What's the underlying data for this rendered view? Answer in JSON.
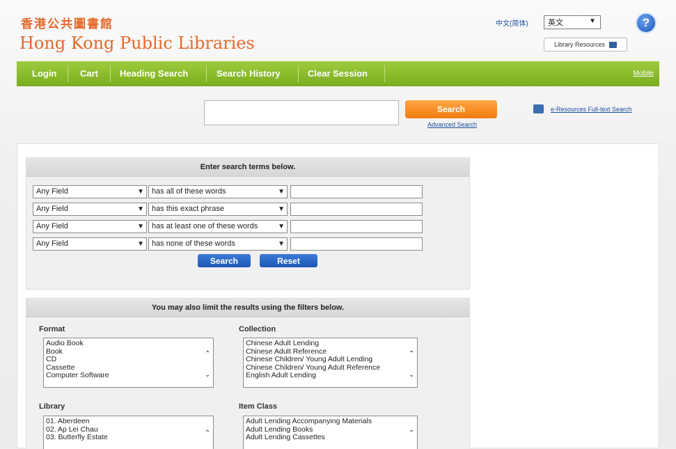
{
  "header": {
    "logo_zh": "香港公共圖書館",
    "logo_en": "Hong Kong Public Libraries",
    "lang_link": "中文(简体)",
    "lang_select_value": "英文",
    "help_label": "?",
    "library_resources": "Library Resources"
  },
  "nav": {
    "items": [
      "Login",
      "Cart",
      "Heading Search",
      "Search History",
      "Clear Session"
    ],
    "mobile": "Mobile"
  },
  "search": {
    "button": "Search",
    "advanced": "Advanced Search",
    "eresources": "e-Resources Full-text Search"
  },
  "terms_box": {
    "header": "Enter search terms below.",
    "rows": [
      {
        "field": "Any Field",
        "match": "has all of these words"
      },
      {
        "field": "Any Field",
        "match": "has this exact phrase"
      },
      {
        "field": "Any Field",
        "match": "has at least one of these words"
      },
      {
        "field": "Any Field",
        "match": "has none of these words"
      }
    ],
    "search_btn": "Search",
    "reset_btn": "Reset"
  },
  "filters_box": {
    "header": "You may also limit the results using the filters below.",
    "format": {
      "label": "Format",
      "options": [
        "Audio Book",
        "Book",
        "CD",
        "Cassette",
        "Computer Software"
      ]
    },
    "collection": {
      "label": "Collection",
      "options": [
        "Chinese Adult Lending",
        "Chinese Adult Reference",
        "Chinese Children/ Young Adult Lending",
        "Chinese Children/ Young Adult Reference",
        "English Adult Lending"
      ]
    },
    "library": {
      "label": "Library",
      "options": [
        "01. Aberdeen",
        "02. Ap Lei Chau",
        "03. Butterfly Estate"
      ]
    },
    "item_class": {
      "label": "Item Class",
      "options": [
        "Adult Lending Accompanying Materials",
        "Adult Lending Books",
        "Adult Lending Cassettes"
      ]
    }
  },
  "colors": {
    "brand_orange": "#e4682a",
    "nav_green": "#8cbd2c",
    "button_blue": "#1b57b4",
    "search_orange": "#f58a1f"
  }
}
